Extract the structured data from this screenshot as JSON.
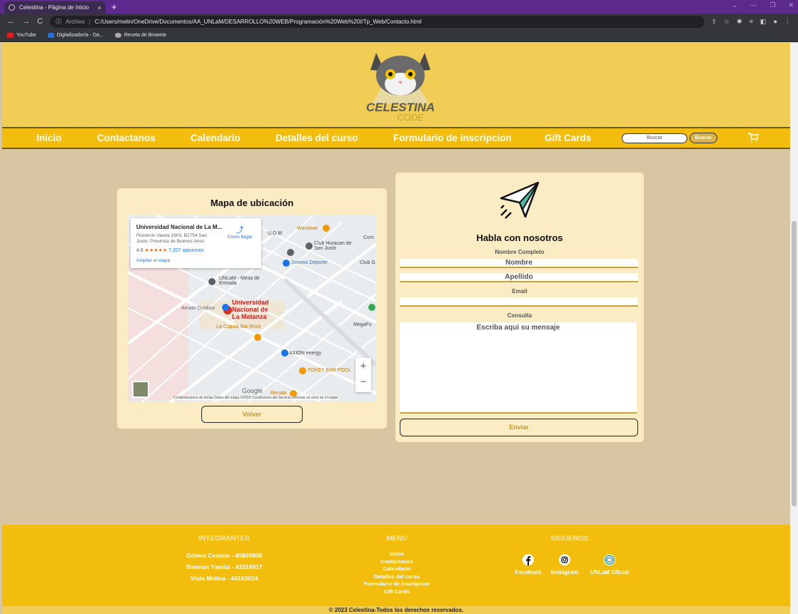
{
  "browser": {
    "tab_title": "Celestina - Página de Inicio",
    "tab_close": "×",
    "new_tab": "+",
    "url_label": "Archivo",
    "url": "C:/Users/melin/OneDrive/Documentos/AA_UNLaM/DESARROLLO%20WEB/Programación%20Web%20I/Tp_Web/Contacto.html",
    "bookmarks": [
      "YouTube",
      "Digitalizador/a - Da...",
      "Receta de Brownie"
    ]
  },
  "header": {
    "logo_text": "CELESTINA CODE",
    "nav": [
      "Inicio",
      "Contactanos",
      "Calendario",
      "Detalles del curso",
      "Formulario de inscripcion",
      "Gift Cards"
    ],
    "search_placeholder": "Buscar",
    "search_button": "Buscar"
  },
  "map_card": {
    "title": "Mapa de ubicación",
    "place_name": "Universidad Nacional de La M...",
    "place_address": "Florencio Varela 1903, B1754 San Justo, Provincia de Buenos Aires",
    "rating": "4.8",
    "reviews": "7,207 opiniones",
    "directions": "Cómo llegar",
    "expand": "Ampliar el mapa",
    "labels": [
      "U.O.M",
      "Wanawar",
      "Club Huracan de San Justo",
      "Sonnos Deporte",
      "UNLaM - Mesa de Entrada",
      "Amato Outdoor",
      "Universidad Nacional de La Matanza",
      "La Cúpula Bar Rock",
      "MegaFu",
      "AXION energy",
      "TOKEY BAR POOL",
      "Renata",
      "Club G",
      "Com",
      "Google"
    ],
    "footer": "Combinaciones de teclas   Datos del mapa ©2023   Condiciones del Servicio   Informar un error en el mapa",
    "back_button": "Volver"
  },
  "form_card": {
    "title": "Habla con nosotros",
    "name_label": "Nombre Completo",
    "first_placeholder": "Nombre",
    "last_placeholder": "Apellido",
    "email_label": "Email",
    "query_label": "Consulta",
    "message_placeholder": "Escriba aqui su mensaje",
    "submit": "Enviar"
  },
  "footer": {
    "members_title": "INTEGRANTES",
    "members": [
      "Gómez Celeste - 45809908",
      "Sleiman Yamila - 43316917",
      "Viola Melina - 44163024"
    ],
    "menu_title": "MENU",
    "menu": [
      "Inicio",
      "Contactanos",
      "Calendario",
      "Detalles del curso",
      "Formulario de inscripcion",
      "Gift Cards"
    ],
    "follow_title": "SIGUENOS",
    "social": [
      "Facebook",
      "Instagram",
      "UNLaM Oficial"
    ],
    "copyright": "© 2023 Celestina-Todos los derechos reservados."
  }
}
